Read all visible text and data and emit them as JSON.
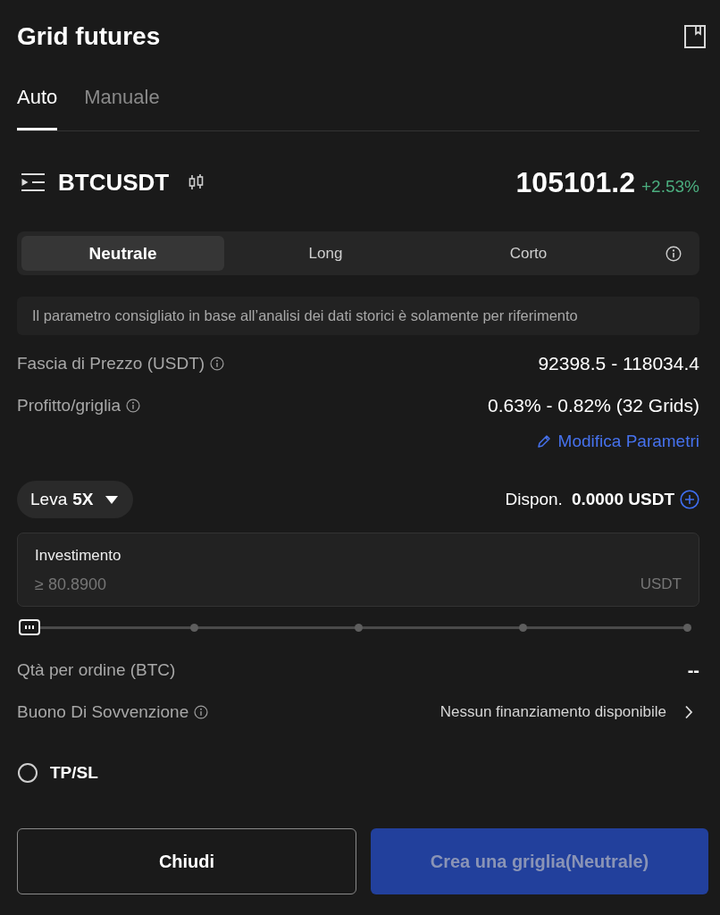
{
  "header": {
    "title": "Grid futures"
  },
  "tabs": [
    {
      "label": "Auto",
      "selected": true
    },
    {
      "label": "Manuale",
      "selected": false
    }
  ],
  "symbol": {
    "name": "BTCUSDT",
    "price": "105101.2",
    "change": "+2.53%"
  },
  "modes": [
    {
      "label": "Neutrale",
      "selected": true
    },
    {
      "label": "Long",
      "selected": false
    },
    {
      "label": "Corto",
      "selected": false
    }
  ],
  "notice": "Il parametro consigliato in base all’analisi dei dati storici è solamente per riferimento",
  "params": [
    {
      "label": "Fascia di Prezzo (USDT)",
      "value": "92398.5 - 118034.4",
      "info": true
    },
    {
      "label": "Profitto/griglia",
      "value": "0.63% - 0.82% (32 Grids)",
      "info": true
    }
  ],
  "edit_link": "Modifica Parametri",
  "leverage": {
    "label": "Leva",
    "value": "5X"
  },
  "available": {
    "label": "Dispon.",
    "value": "0.0000 USDT"
  },
  "investment": {
    "label": "Investimento",
    "placeholder": "≥ 80.8900",
    "unit": "USDT"
  },
  "slider": {
    "level": 0
  },
  "details": [
    {
      "kind": "value",
      "label": "Qtà per ordine (BTC)",
      "value": "--",
      "info": false
    },
    {
      "kind": "link",
      "label": "Buono Di Sovvenzione",
      "value": "Nessun finanziamento disponibile",
      "info": true
    }
  ],
  "tpsl": {
    "label": "TP/SL",
    "checked": false
  },
  "buttons": [
    {
      "label": "Chiudi",
      "kind": "secondary",
      "disabled": false
    },
    {
      "label": "Crea una griglia(Neutrale)",
      "kind": "primary",
      "disabled": true
    }
  ]
}
